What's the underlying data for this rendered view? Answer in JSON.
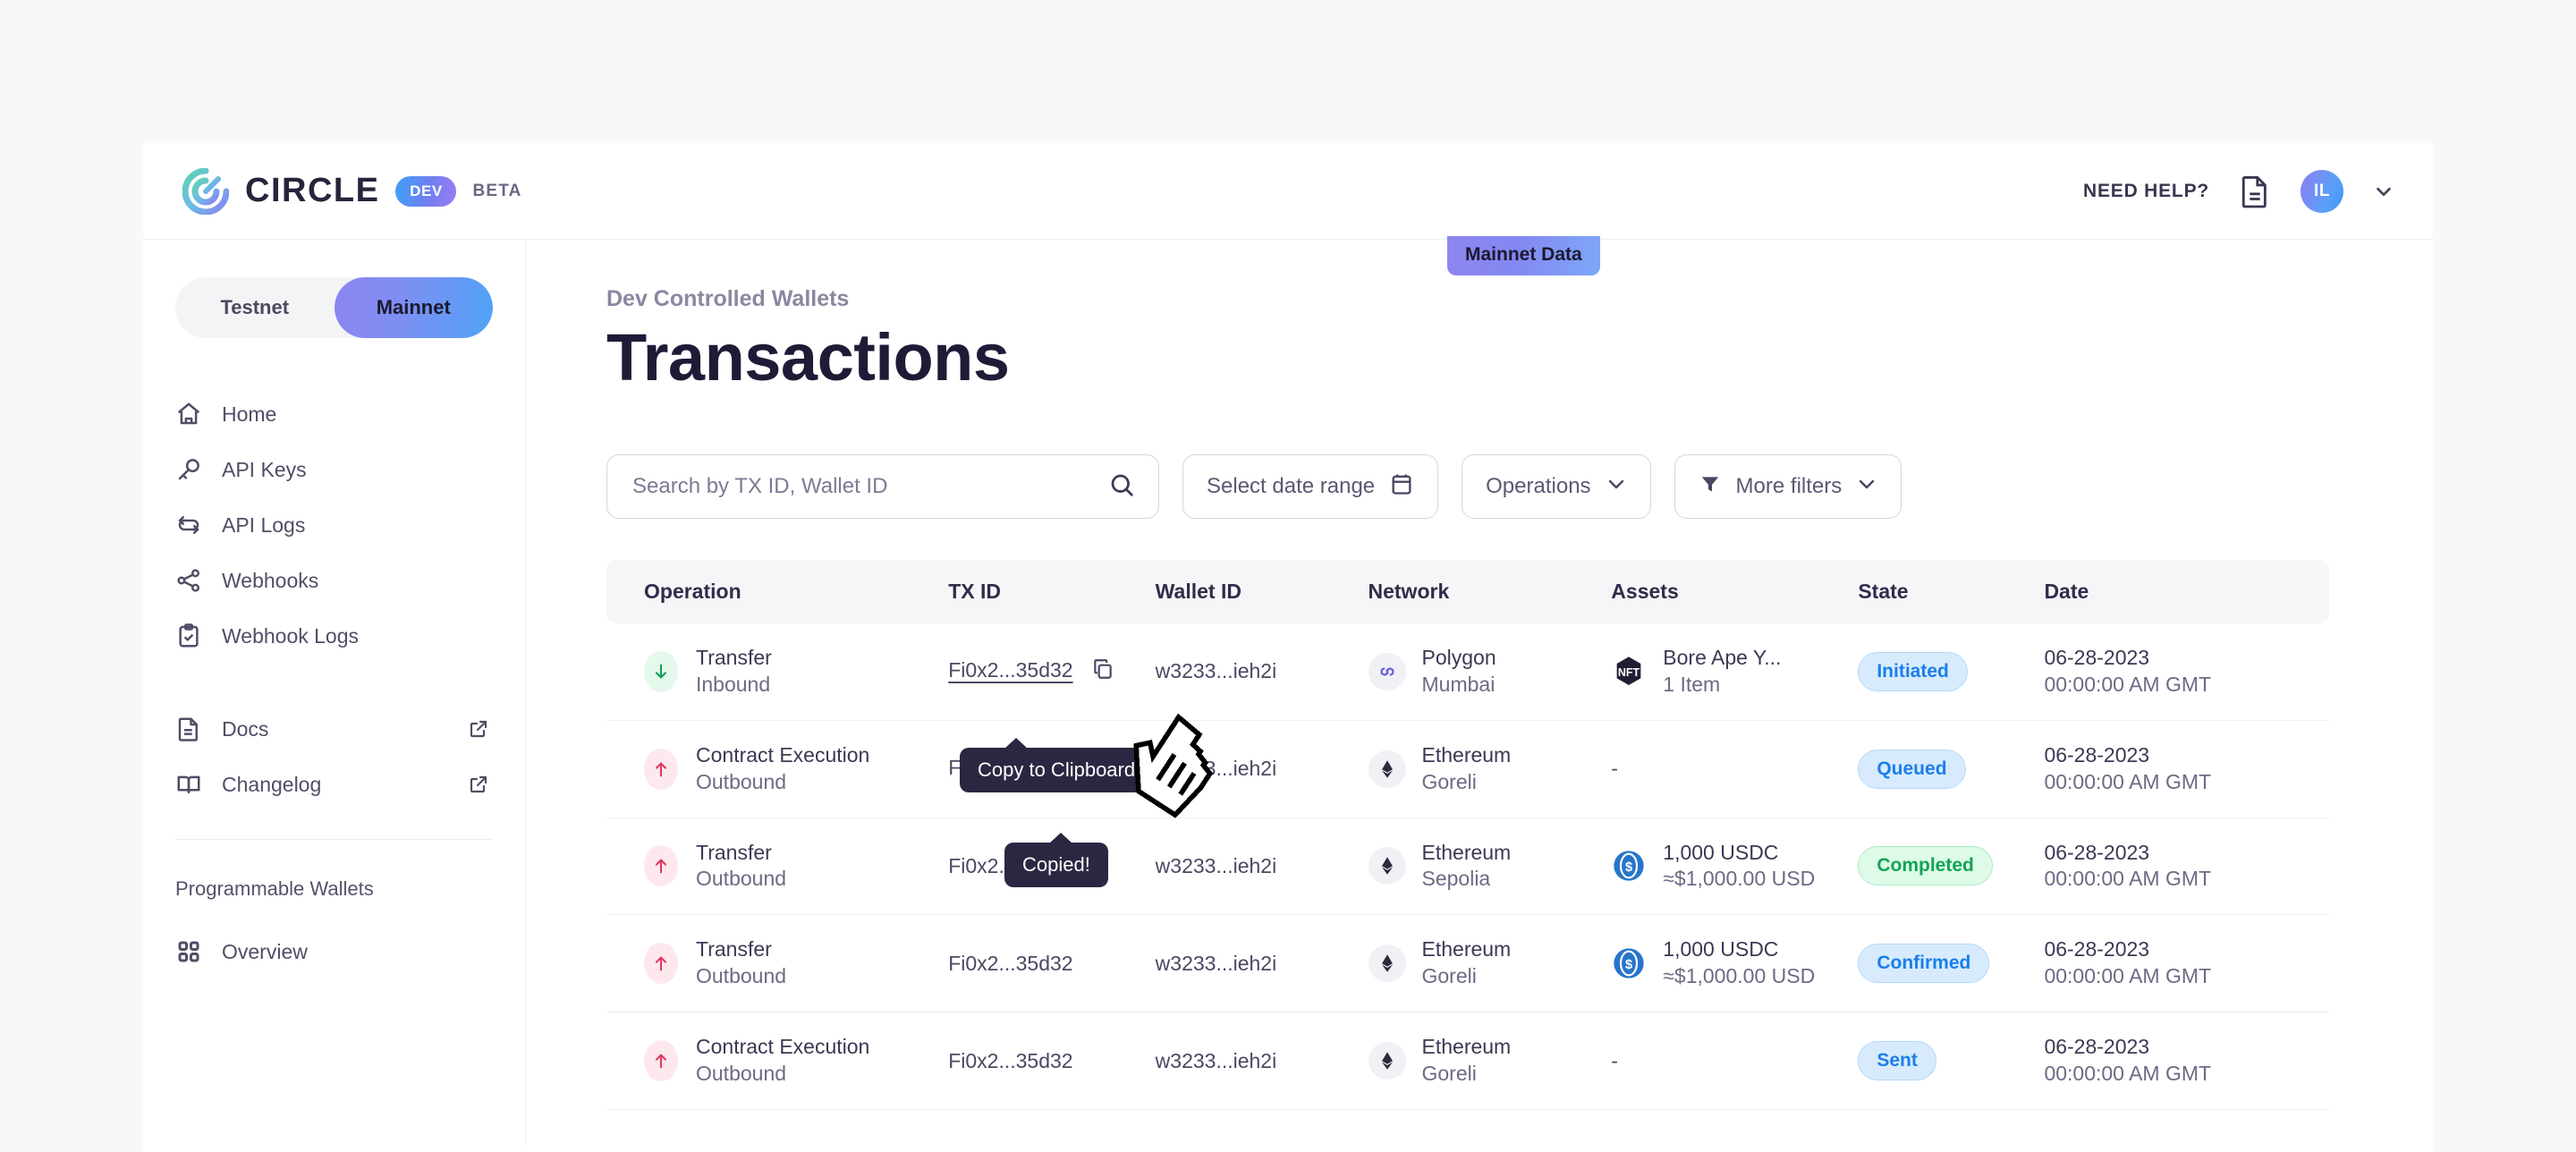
{
  "header": {
    "brand_name": "CIRCLE",
    "dev_pill": "DEV",
    "beta_label": "BETA",
    "need_help": "NEED HELP?",
    "doc_icon": "document-icon",
    "avatar_initials": "IL",
    "chevron_icon": "chevron-down-icon",
    "accent_gradient_from": "#6e7bf2",
    "accent_gradient_to": "#1f9bfb"
  },
  "sidebar": {
    "network_toggle": {
      "testnet_label": "Testnet",
      "mainnet_label": "Mainnet",
      "selected": "Mainnet"
    },
    "items": [
      {
        "label": "Home",
        "icon": "home-icon",
        "external": false
      },
      {
        "label": "API Keys",
        "icon": "key-icon",
        "external": false
      },
      {
        "label": "API Logs",
        "icon": "refresh-icon",
        "external": false
      },
      {
        "label": "Webhooks",
        "icon": "share-nodes-icon",
        "external": false
      },
      {
        "label": "Webhook Logs",
        "icon": "clipboard-check-icon",
        "external": false
      }
    ],
    "links": [
      {
        "label": "Docs",
        "icon": "document-icon",
        "external": true
      },
      {
        "label": "Changelog",
        "icon": "book-icon",
        "external": true
      }
    ],
    "section_title": "Programmable Wallets",
    "section_items": [
      {
        "label": "Overview",
        "icon": "grid-icon",
        "external": false
      }
    ],
    "external_icon": "external-link-icon"
  },
  "main": {
    "mainnet_badge": "Mainnet Data",
    "eyebrow": "Dev Controlled Wallets",
    "title": "Transactions",
    "toolbar": {
      "search_placeholder": "Search by TX ID, Wallet ID",
      "search_value": "",
      "search_icon": "search-icon",
      "date_range_label": "Select date range",
      "calendar_icon": "calendar-icon",
      "operations_label": "Operations",
      "operations_chevron": "chevron-down-icon",
      "more_filters_label": "More filters",
      "filter_icon": "funnel-icon",
      "more_filters_chevron": "chevron-down-icon"
    },
    "table": {
      "columns": [
        "Operation",
        "TX ID",
        "Wallet ID",
        "Network",
        "Assets",
        "State",
        "Date"
      ],
      "rows": [
        {
          "operation": "Transfer",
          "direction": "Inbound",
          "direction_type": "in",
          "tx_id": "Fi0x2...35d32",
          "tx_icon": "copy-icon",
          "wallet_id": "w3233...ieh2i",
          "network": "Polygon",
          "network_sub": "Mumbai",
          "network_icon": "polygon-icon",
          "asset_icon": "nft-icon",
          "asset_primary": "Bore Ape Y...",
          "asset_secondary": "1 Item",
          "state": "Initiated",
          "state_color": "blue",
          "date": "06-28-2023",
          "time": "00:00:00 AM GMT"
        },
        {
          "operation": "Contract Execution",
          "direction": "Outbound",
          "direction_type": "out",
          "tx_id": "Fi0x2...35d32",
          "tx_icon": "check-icon",
          "wallet_id": "w3233...ieh2i",
          "network": "Ethereum",
          "network_sub": "Goreli",
          "network_icon": "ethereum-icon",
          "asset_icon": "",
          "asset_primary": "-",
          "asset_secondary": "",
          "state": "Queued",
          "state_color": "blue",
          "date": "06-28-2023",
          "time": "00:00:00 AM GMT"
        },
        {
          "operation": "Transfer",
          "direction": "Outbound",
          "direction_type": "out",
          "tx_id": "Fi0x2...35d32",
          "tx_icon": "",
          "wallet_id": "w3233...ieh2i",
          "network": "Ethereum",
          "network_sub": "Sepolia",
          "network_icon": "ethereum-icon",
          "asset_icon": "usdc-icon",
          "asset_primary": "1,000 USDC",
          "asset_secondary": "≈$1,000.00 USD",
          "state": "Completed",
          "state_color": "green",
          "date": "06-28-2023",
          "time": "00:00:00 AM GMT"
        },
        {
          "operation": "Transfer",
          "direction": "Outbound",
          "direction_type": "out",
          "tx_id": "Fi0x2...35d32",
          "tx_icon": "",
          "wallet_id": "w3233...ieh2i",
          "network": "Ethereum",
          "network_sub": "Goreli",
          "network_icon": "ethereum-icon",
          "asset_icon": "usdc-icon",
          "asset_primary": "1,000 USDC",
          "asset_secondary": "≈$1,000.00 USD",
          "state": "Confirmed",
          "state_color": "blue",
          "date": "06-28-2023",
          "time": "00:00:00 AM GMT"
        },
        {
          "operation": "Contract Execution",
          "direction": "Outbound",
          "direction_type": "out",
          "tx_id": "Fi0x2...35d32",
          "tx_icon": "",
          "wallet_id": "w3233...ieh2i",
          "network": "Ethereum",
          "network_sub": "Goreli",
          "network_icon": "ethereum-icon",
          "asset_icon": "",
          "asset_primary": "-",
          "asset_secondary": "",
          "state": "Sent",
          "state_color": "blue",
          "date": "06-28-2023",
          "time": "00:00:00 AM GMT"
        }
      ]
    },
    "tooltips": {
      "copy_to_clipboard": "Copy to Clipboard",
      "copied": "Copied!"
    }
  }
}
